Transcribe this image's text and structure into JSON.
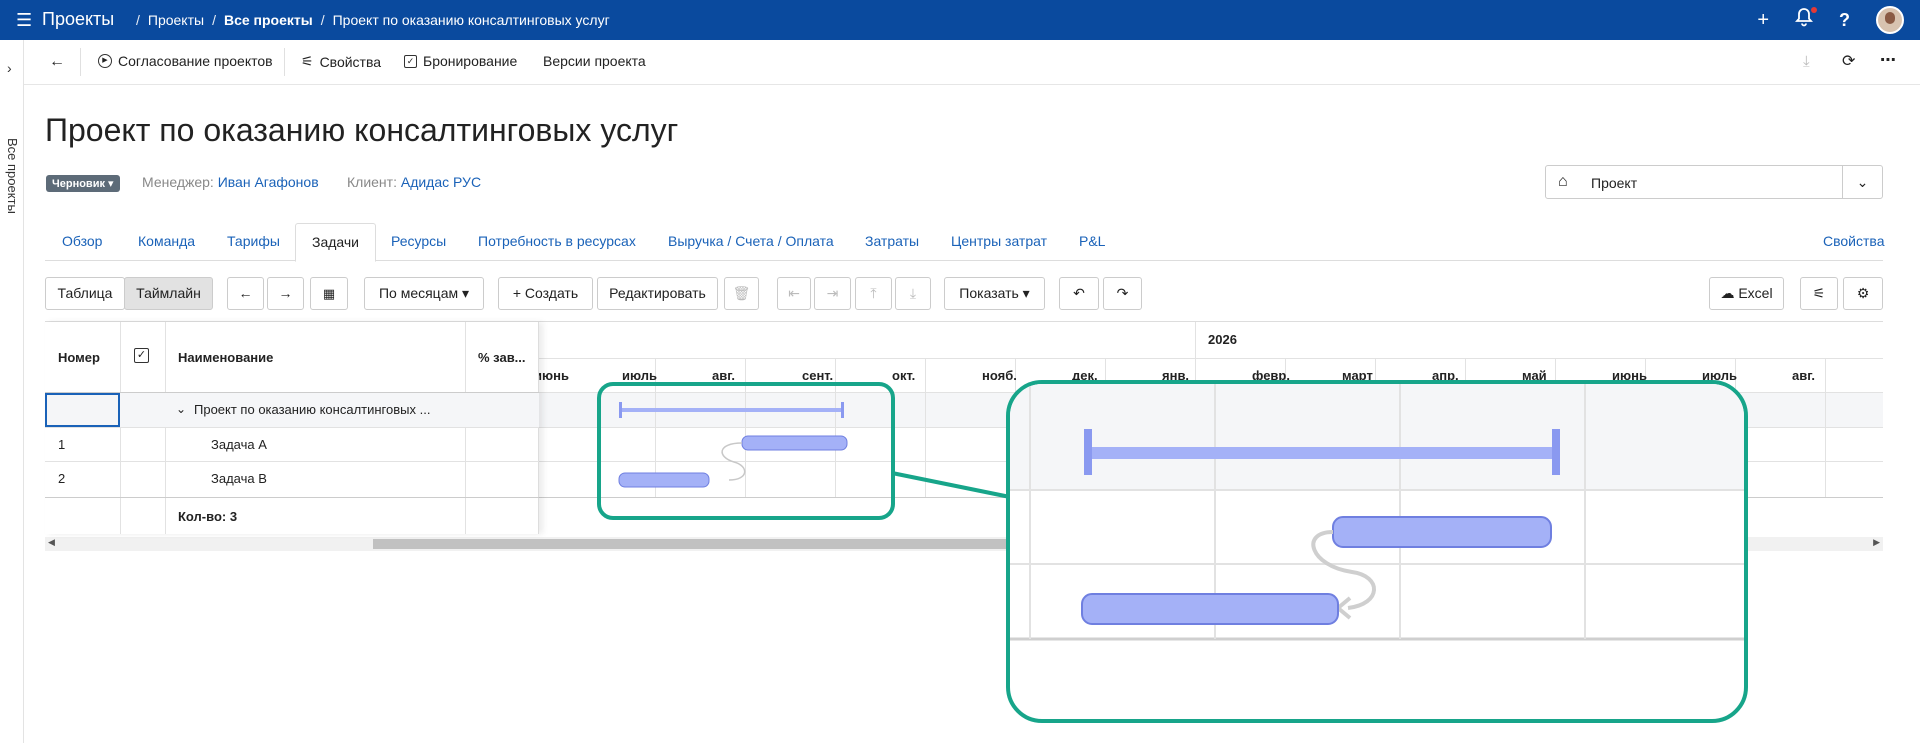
{
  "topbar": {
    "app_name": "Проекты",
    "breadcrumbs": [
      "Проекты",
      "Все проекты",
      "Проект по оказанию консалтинговых услуг"
    ],
    "icons": [
      "menu-icon",
      "plus-icon",
      "bell-icon",
      "help-icon",
      "avatar"
    ]
  },
  "leftrail": {
    "label": "Все проекты"
  },
  "toolbar": {
    "approve": "Согласование проектов",
    "properties": "Свойства",
    "booking": "Бронирование",
    "versions": "Версии проекта"
  },
  "project": {
    "title": "Проект по оказанию консалтинговых услуг",
    "status": "Черновик",
    "manager_label": "Менеджер:",
    "manager": "Иван Агафонов",
    "client_label": "Клиент:",
    "client": "Адидас РУС",
    "type_select": "Проект"
  },
  "tabs": [
    "Обзор",
    "Команда",
    "Тарифы",
    "Задачи",
    "Ресурсы",
    "Потребность в ресурсах",
    "Выручка / Счета / Оплата",
    "Затраты",
    "Центры затрат",
    "P&L"
  ],
  "tabs_right": "Свойства",
  "gridtoolbar": {
    "table": "Таблица",
    "timeline": "Таймлайн",
    "period": "По месяцам",
    "create": "Создать",
    "edit": "Редактировать",
    "show": "Показать",
    "excel": "Excel"
  },
  "table": {
    "headers": {
      "number": "Номер",
      "name": "Наименование",
      "percent": "% зав..."
    },
    "rows": [
      {
        "number": "",
        "name": "Проект по оказанию консалтинговых ..."
      },
      {
        "number": "1",
        "name": "Задача A"
      },
      {
        "number": "2",
        "name": "Задача B"
      }
    ],
    "footer": "Кол-во: 3"
  },
  "timeline": {
    "year": "2026",
    "months": [
      "июнь",
      "июль",
      "авг.",
      "сент.",
      "окт.",
      "нояб.",
      "дек.",
      "янв.",
      "февр.",
      "март",
      "апр.",
      "май",
      "июнь",
      "июль",
      "авг."
    ]
  },
  "colors": {
    "accent": "#0a4a9e",
    "bar": "#a4b1f7",
    "bar_border": "#6f7fe0",
    "zoom": "#17a58a"
  }
}
